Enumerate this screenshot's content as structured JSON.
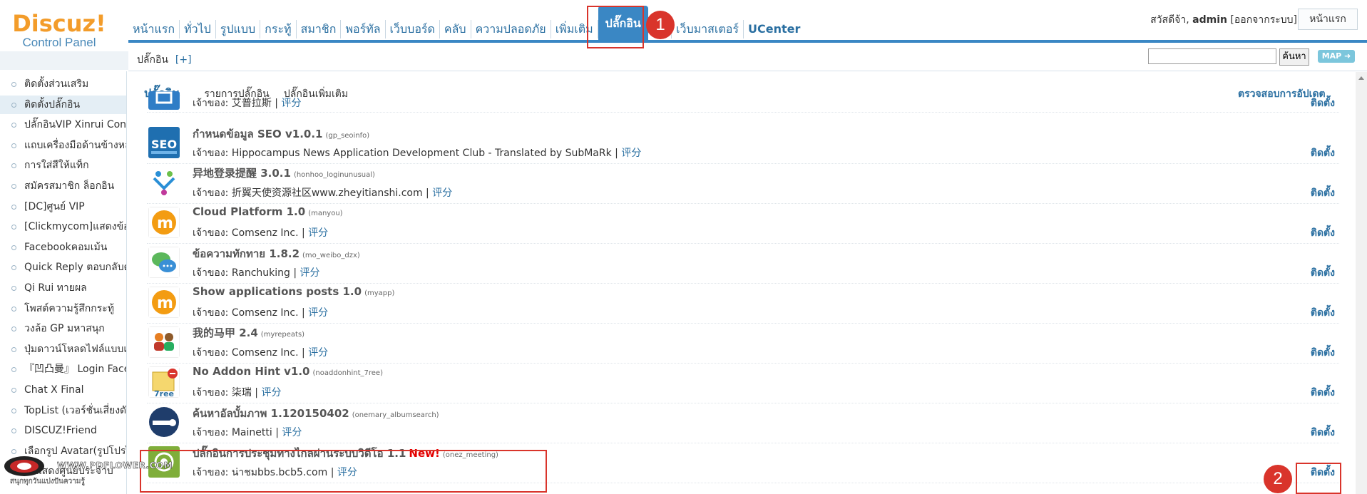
{
  "logo": {
    "word": "Discuz!",
    "sub": "Control Panel"
  },
  "nav": {
    "items": [
      "หน้าแรก",
      "ทั่วไป",
      "รูปแบบ",
      "กระทู้",
      "สมาชิก",
      "พอร์ทัล",
      "เว็บบอร์ด",
      "คลับ",
      "ความปลอดภัย",
      "เพิ่มเติม",
      "ปลั๊กอิน",
      "มือ",
      "เว็บมาสเตอร์",
      "UCenter"
    ],
    "active_index": 10
  },
  "user": {
    "greeting": "สวัสดีจ้า, ",
    "name": "admin",
    "logout": "[ออกจากระบบ]",
    "home_button": "หน้าแรก"
  },
  "subbar": {
    "crumb": "ปลั๊กอิน",
    "crumb_plus": "[+]",
    "search_button": "ค้นหา",
    "map_button": "MAP ➜"
  },
  "sidebar": {
    "items": [
      "ติดตั้งส่วนเสริม",
      "ติดตั้งปลั๊กอิน",
      "ปลั๊กอินVIP Xinrui Con",
      "แถบเครื่องมือด้านข้างหล",
      "การใส่สีให้แท็ก",
      "สมัครสมาชิก ล็อกอิน",
      "[DC]ศูนย์ VIP",
      "[Clickmycom]แสดงข้อ",
      "Facebookคอมเม้น",
      "Quick Reply ตอบกลับด",
      "Qi Rui ทายผล",
      "โพสต์ความรู้สึกกระทู้",
      "วงล้อ GP มหาสนุก",
      "ปุ่มดาวน์โหลดไฟล์แบบแ",
      "『凹凸曼』 Login Face",
      "Chat X Final",
      "TopList (เวอร์ชั่นเสี่ยงดัง)",
      "DISCUZ!Friend",
      "เลือกรูป Avatar(รูปโปรไ",
      "ใบแสดงศูนย์ประจำบ"
    ],
    "active_index": 1
  },
  "main": {
    "tabs": [
      "ปลั๊กอิน",
      "รายการปลั๊กอิน",
      "ปลั๊กอินเพิ่มเติม"
    ],
    "check_updates": "ตรวจสอบการอัปเดต",
    "install_label": "ติดตั้ง",
    "owner_prefix": "เจ้าของ: ",
    "rate_label": "评分",
    "plugins": [
      {
        "title": "",
        "id": "",
        "owner": "艾普拉斯",
        "icon": "blue-box-icon"
      },
      {
        "title": "กำหนดข้อมูล SEO v1.0.1",
        "id": "(gp_seoinfo)",
        "owner": "Hippocampus News Application Development Club - Translated by SubMaRk",
        "icon": "seo-icon"
      },
      {
        "title": "异地登录提醒 3.0.1",
        "id": "(honhoo_loginunusual)",
        "owner": "折翼天使资源社区www.zheyitianshi.com",
        "icon": "people-logo-icon"
      },
      {
        "title": "Cloud Platform 1.0",
        "id": "(manyou)",
        "owner": "Comsenz Inc.",
        "icon": "manyou-icon"
      },
      {
        "title": "ข้อความทักทาย 1.8.2",
        "id": "(mo_weibo_dzx)",
        "owner": "Ranchuking",
        "icon": "chat-bubbles-icon"
      },
      {
        "title": "Show applications posts 1.0",
        "id": "(myapp)",
        "owner": "Comsenz Inc.",
        "icon": "manyou-icon"
      },
      {
        "title": "我的马甲 2.4",
        "id": "(myrepeats)",
        "owner": "Comsenz Inc.",
        "icon": "users-icon"
      },
      {
        "title": "No Addon Hint v1.0",
        "id": "(noaddonhint_7ree)",
        "owner": "柒瑞",
        "icon": "7ree-folder-icon"
      },
      {
        "title": "ค้นหาอัลบั้มภาพ 1.120150402",
        "id": "(onemary_albumsearch)",
        "owner": "Mainetti",
        "icon": "album-search-icon"
      },
      {
        "title": "ปลั๊กอินการประชุมทางไกลผ่านระบบวิดีโอ 1.1",
        "new": "New!",
        "id": "(onez_meeting)",
        "owner": "น่าชมbbs.bcb5.com",
        "icon": "meeting-icon"
      }
    ]
  },
  "annotations": {
    "one": "1",
    "two": "2"
  },
  "watermark": {
    "text": "WWW.PDFLOWER.COM",
    "sub": "สนุกทุกวันแบ่งปันความรู้"
  }
}
